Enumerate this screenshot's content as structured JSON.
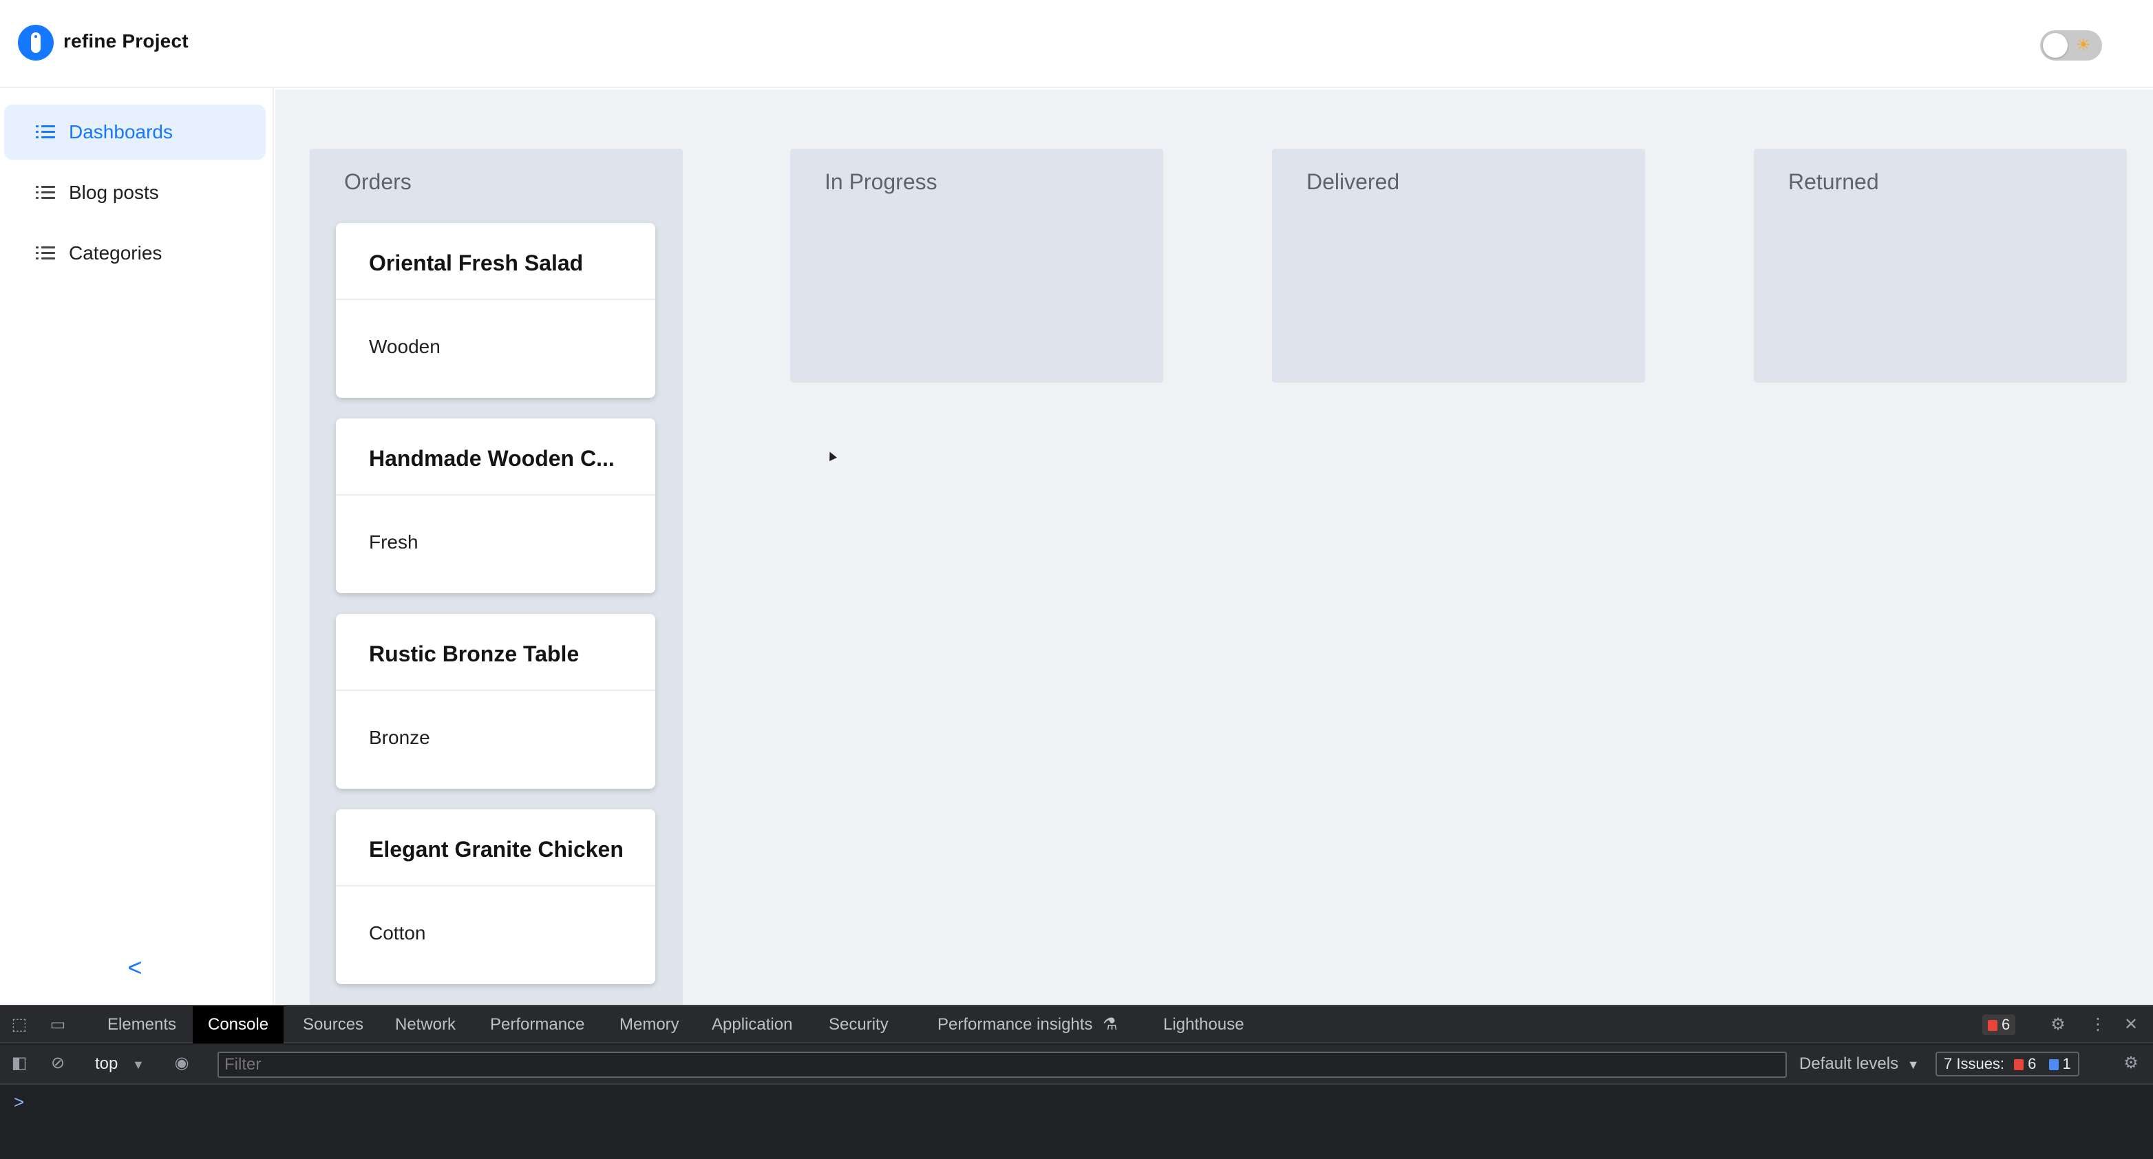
{
  "header": {
    "app_title": "refine Project",
    "theme_toggle": {
      "state": "light",
      "icon": "sun-icon"
    }
  },
  "sidebar": {
    "items": [
      {
        "label": "Dashboards",
        "icon": "list-icon",
        "active": true
      },
      {
        "label": "Blog posts",
        "icon": "list-icon",
        "active": false
      },
      {
        "label": "Categories",
        "icon": "list-icon",
        "active": false
      }
    ],
    "collapse_glyph": "<"
  },
  "board": {
    "columns": [
      {
        "title": "Orders",
        "cards": [
          {
            "title": "Oriental Fresh Salad",
            "subtitle": "Wooden"
          },
          {
            "title": "Handmade Wooden C...",
            "subtitle": "Fresh"
          },
          {
            "title": "Rustic Bronze Table",
            "subtitle": "Bronze"
          },
          {
            "title": "Elegant Granite Chicken",
            "subtitle": "Cotton"
          }
        ]
      },
      {
        "title": "In Progress",
        "cards": []
      },
      {
        "title": "Delivered",
        "cards": []
      },
      {
        "title": "Returned",
        "cards": []
      }
    ]
  },
  "devtools": {
    "tabs": [
      "Elements",
      "Console",
      "Sources",
      "Network",
      "Performance",
      "Memory",
      "Application",
      "Security",
      "Performance insights",
      "Lighthouse"
    ],
    "active_tab": "Console",
    "error_count": "6",
    "context": "top",
    "filter_placeholder": "Filter",
    "levels_label": "Default levels",
    "issues_label": "7 Issues:",
    "issues_errors": "6",
    "issues_info": "1",
    "prompt_glyph": ">",
    "colors": {
      "error_flag": "#e8453c",
      "info_flag": "#4c8bf5"
    }
  },
  "colors": {
    "accent": "#1677ff",
    "active_nav_bg": "#e6f0fe",
    "column_bg": "#dfe4ec",
    "content_bg": "#f0f1f4"
  }
}
